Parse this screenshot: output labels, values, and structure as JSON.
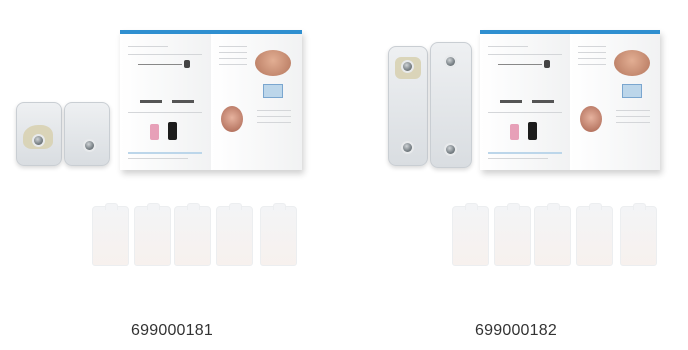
{
  "products": [
    {
      "id": "product-699000181",
      "label": "699000181"
    },
    {
      "id": "product-699000182",
      "label": "699000182"
    }
  ],
  "colors": {
    "booklet_accent": "#2f8fd0",
    "caption_text": "#333333"
  }
}
